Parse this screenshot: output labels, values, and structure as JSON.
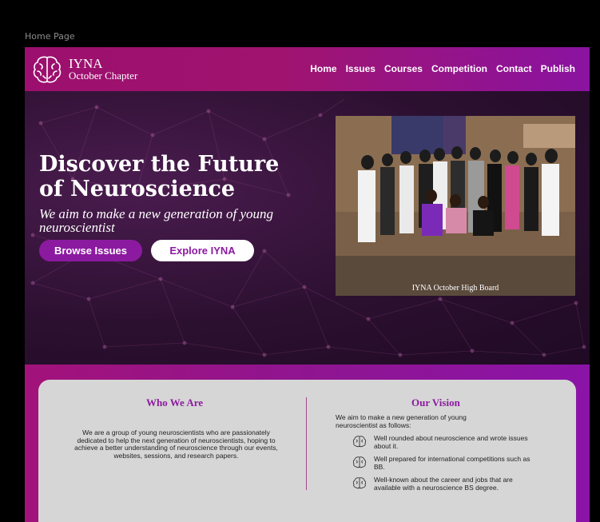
{
  "frame": {
    "label": "Home Page"
  },
  "header": {
    "brand_name": "IYNA",
    "brand_sub": "October Chapter",
    "nav": [
      "Home",
      "Issues",
      "Courses",
      "Competition",
      "Contact",
      "Publish"
    ]
  },
  "hero": {
    "title": "Discover the Future of Neuroscience",
    "subtitle": "We aim to make a new generation of young neuroscientist",
    "browse_label": "Browse Issues",
    "explore_label": "Explore IYNA",
    "photo_caption": "IYNA October High Board"
  },
  "about": {
    "who_title": "Who We Are",
    "who_text": "We are a group of young neuroscientists who are passionately dedicated to help the next generation of neuroscientists, hoping to achieve a better understanding of neuroscience through our events, websites, sessions, and research papers.",
    "vision_title": "Our Vision",
    "vision_intro": "We aim to make a new generation of young neuroscientist as follows:",
    "vision_items": [
      "Well rounded about neuroscience and wrote issues about it.",
      "Well prepared for international competitions such as BB.",
      "Well-known about the career and jobs that are available with a neuroscience BS degree."
    ]
  },
  "colors": {
    "brand_purple": "#8c1aa0",
    "header_magenta": "#9c0f6e",
    "card_gray": "#d6d6d6"
  },
  "icons": [
    "brain-icon"
  ]
}
